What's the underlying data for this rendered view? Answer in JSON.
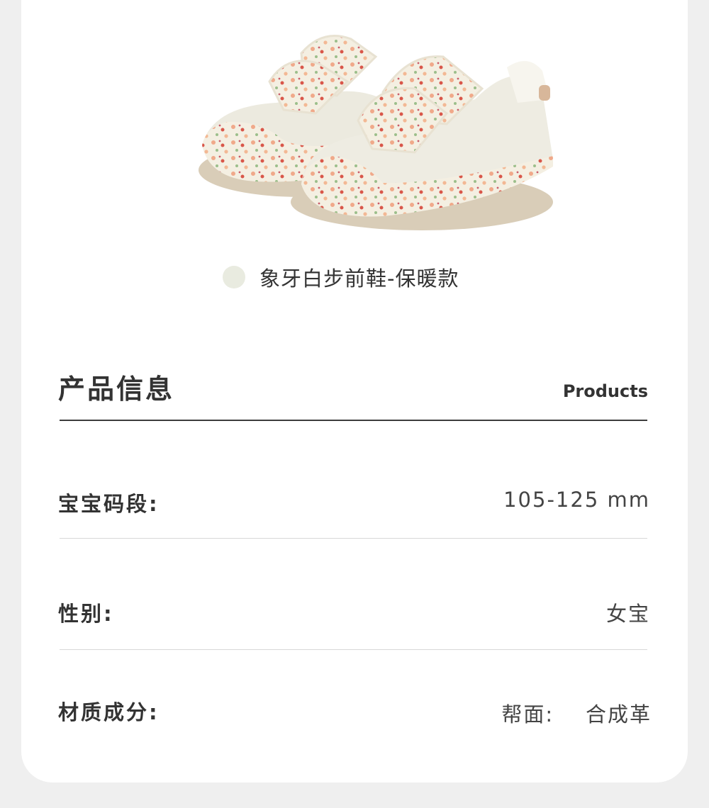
{
  "product": {
    "variant_color": "#e9ebe0",
    "variant_name": "象牙白步前鞋-保暖款",
    "image_label": "ivory baby pre-walker shoes with floral print",
    "icon": "color-swatch"
  },
  "section": {
    "title": "产品信息",
    "subtitle": "Products"
  },
  "specs": [
    {
      "label": "宝宝码段:",
      "value": "105-125  mm"
    },
    {
      "label": "性别:",
      "value": "女宝"
    },
    {
      "label": "材质成分:",
      "value": "帮面:    合成革"
    }
  ],
  "colors": {
    "background": "#efefef",
    "card": "#ffffff",
    "text": "#333333"
  }
}
